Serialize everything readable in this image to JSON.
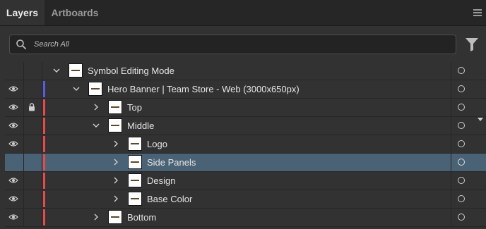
{
  "tabs": [
    {
      "label": "Layers",
      "active": true
    },
    {
      "label": "Artboards",
      "active": false
    }
  ],
  "search": {
    "placeholder": "Search All"
  },
  "layers": [
    {
      "name": "Symbol Editing Mode",
      "visible": false,
      "locked": false,
      "color": null,
      "expanded": true,
      "selected": false
    },
    {
      "name": "Hero Banner | Team Store - Web (3000x650px)",
      "visible": true,
      "locked": false,
      "color": "#5a5ae6",
      "expanded": true,
      "selected": false
    },
    {
      "name": "Top",
      "visible": true,
      "locked": true,
      "color": "#e64b4b",
      "expanded": false,
      "selected": false
    },
    {
      "name": "Middle",
      "visible": true,
      "locked": false,
      "color": "#e64b4b",
      "expanded": true,
      "selected": false
    },
    {
      "name": "Logo",
      "visible": true,
      "locked": false,
      "color": "#e64b4b",
      "expanded": false,
      "selected": false
    },
    {
      "name": "Side Panels",
      "visible": false,
      "locked": false,
      "color": "#e64b4b",
      "expanded": false,
      "selected": true
    },
    {
      "name": "Design",
      "visible": true,
      "locked": false,
      "color": "#e64b4b",
      "expanded": false,
      "selected": false
    },
    {
      "name": "Base Color",
      "visible": true,
      "locked": false,
      "color": "#e64b4b",
      "expanded": false,
      "selected": false
    },
    {
      "name": "Bottom",
      "visible": true,
      "locked": false,
      "color": "#e64b4b",
      "expanded": false,
      "selected": false
    }
  ],
  "colors": {
    "panel_bg": "#323232",
    "selection": "#4a6275",
    "layer_red": "#e64b4b",
    "layer_blue": "#5a5ae6"
  },
  "icons": {
    "visibility": "eye-icon",
    "lock": "lock-icon",
    "expand": "chevron-icon",
    "target": "target-circle-icon",
    "filter": "filter-icon",
    "search": "search-icon",
    "menu": "panel-menu-icon"
  }
}
